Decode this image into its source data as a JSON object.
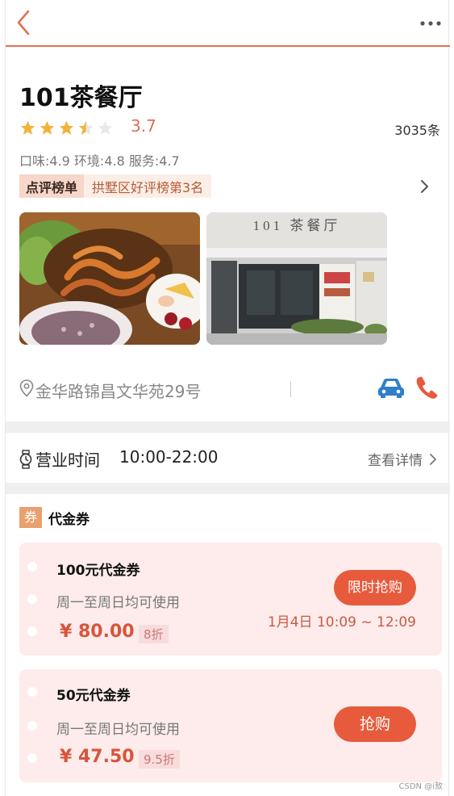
{
  "header": {
    "back_icon": "chevron-left-icon",
    "more_icon": "more-dots-icon",
    "accent": "#e0704f"
  },
  "shop": {
    "name": "101茶餐厅",
    "stars": 3.5,
    "rating": "3.7",
    "reviews": "3035条",
    "subscores": "口味:4.9 环境:4.8 服务:4.7",
    "rank_tag": "点评榜单",
    "rank_text": "拱墅区好评榜第3名"
  },
  "photos": [
    {
      "name": "food-photo"
    },
    {
      "name": "storefront-photo",
      "sign": "101 茶餐厅"
    }
  ],
  "address": {
    "text": "金华路锦昌文华苑29号",
    "pin_icon": "location-pin-icon",
    "car_icon": "car-icon",
    "phone_icon": "phone-icon"
  },
  "hours": {
    "label": "营业时间",
    "value": "10:00-22:00",
    "details": "查看详情"
  },
  "coupons": {
    "badge": "券",
    "title": "代金券",
    "items": [
      {
        "name": "100元代金券",
        "desc": "周一至周日均可使用",
        "price": "¥ 80.00",
        "discount": "8折",
        "button": "限时抢购",
        "time": "1月4日 10:09 ~ 12:09"
      },
      {
        "name": "50元代金券",
        "desc": "周一至周日均可使用",
        "price": "¥ 47.50",
        "discount": "9.5折",
        "button": "抢购"
      }
    ]
  },
  "watermark": "CSDN @i敖"
}
